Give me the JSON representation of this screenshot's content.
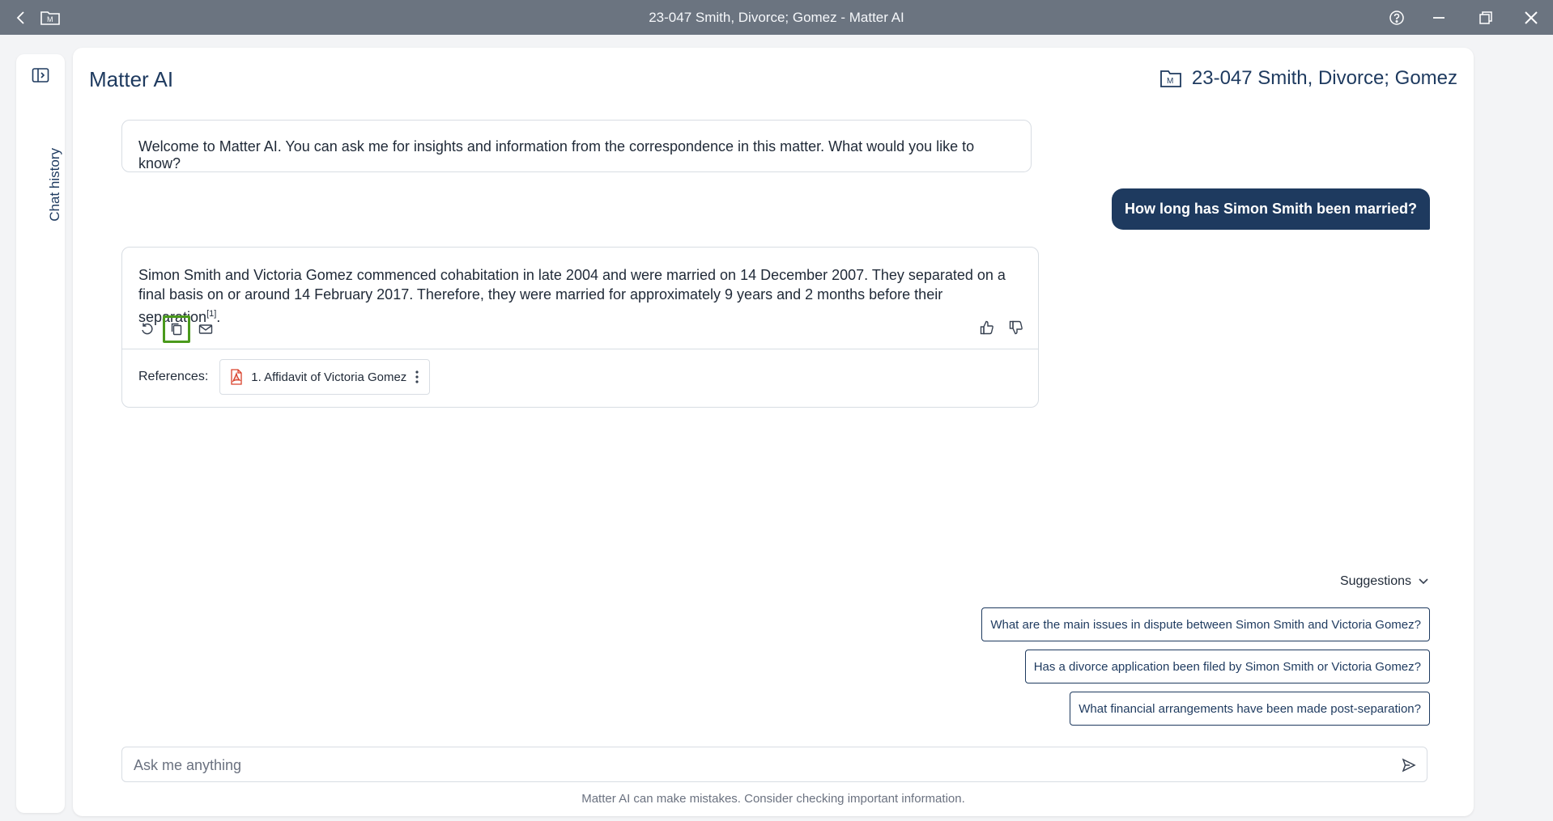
{
  "window": {
    "title": "23-047 Smith, Divorce; Gomez - Matter AI"
  },
  "sidebar": {
    "label": "Chat history"
  },
  "main": {
    "title": "Matter AI",
    "matter_name": "23-047 Smith, Divorce; Gomez"
  },
  "chat": {
    "welcome": "Welcome to Matter AI. You can ask me for insights and information from the correspondence in this matter. What would you like to know?",
    "user_question": "How long has Simon Smith been married?",
    "answer_text": "Simon Smith and Victoria Gomez commenced cohabitation in late 2004 and were married on 14 December 2007. They separated on a final basis on or around 14 February 2017. Therefore, they were married for approximately 9 years and 2 months before their separation",
    "answer_citation": "[1]",
    "answer_end": ".",
    "references_label": "References:",
    "reference_item": "1. Affidavit of Victoria Gomez"
  },
  "suggestions": {
    "label": "Suggestions",
    "items": [
      "What are the main issues in dispute between Simon Smith and Victoria Gomez?",
      "Has a divorce application been filed by Simon Smith or Victoria Gomez?",
      "What financial arrangements have been made post-separation?"
    ]
  },
  "input": {
    "placeholder": "Ask me anything",
    "value": ""
  },
  "footer": {
    "disclaimer": "Matter AI can make mistakes. Consider checking important information."
  },
  "colors": {
    "navy": "#1e3a5f",
    "titlebar": "#6b7480",
    "selected_outline": "#4a9a1c",
    "pdf_red": "#d9412b"
  }
}
